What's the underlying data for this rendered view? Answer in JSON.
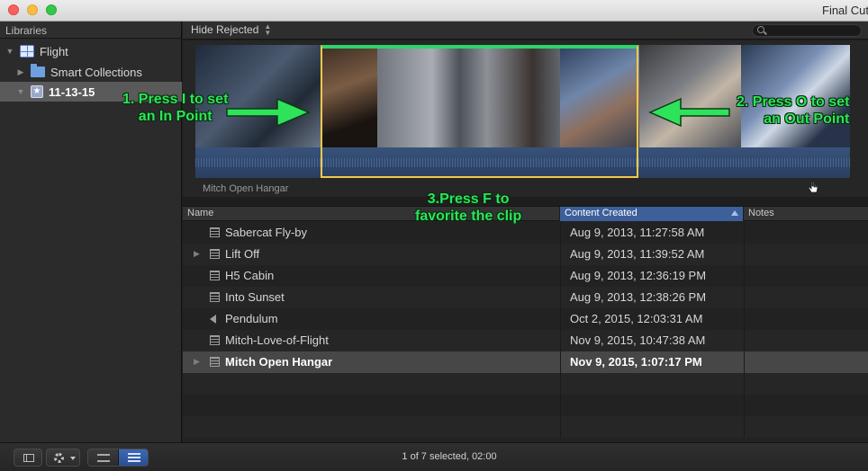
{
  "window": {
    "title": "Final Cut"
  },
  "sidebar": {
    "header": "Libraries",
    "items": [
      {
        "label": "Flight",
        "icon": "library-icon",
        "expanded": true
      },
      {
        "label": "Smart Collections",
        "icon": "folder-icon",
        "expanded": false
      },
      {
        "label": "11-13-15",
        "icon": "event-star-icon",
        "expanded": true,
        "selected": true
      }
    ]
  },
  "toolbar": {
    "filter_label": "Hide Rejected",
    "search_placeholder": ""
  },
  "filmstrip": {
    "clip_label": "Mitch Open Hangar"
  },
  "annotations": {
    "in_line1": "1. Press I to set",
    "in_line2": "an In Point",
    "out_line1": "2. Press O to set",
    "out_line2": "an Out Point",
    "fav_line1": "3.Press F to",
    "fav_line2": "favorite the clip"
  },
  "list": {
    "columns": {
      "name": "Name",
      "content_created": "Content Created",
      "notes": "Notes"
    },
    "rows": [
      {
        "name": "Sabercat Fly-by",
        "created": "Aug 9, 2013, 11:27:58 AM",
        "type": "video",
        "expandable": false
      },
      {
        "name": "Lift Off",
        "created": "Aug 9, 2013, 11:39:52 AM",
        "type": "video",
        "expandable": true
      },
      {
        "name": "H5 Cabin",
        "created": "Aug 9, 2013, 12:36:19 PM",
        "type": "video",
        "expandable": false
      },
      {
        "name": "Into Sunset",
        "created": "Aug 9, 2013, 12:38:26 PM",
        "type": "video",
        "expandable": false
      },
      {
        "name": "Pendulum",
        "created": "Oct 2, 2015, 12:03:31 AM",
        "type": "audio",
        "expandable": false
      },
      {
        "name": "Mitch-Love-of-Flight",
        "created": "Nov 9, 2015, 10:47:38 AM",
        "type": "video",
        "expandable": false
      },
      {
        "name": "Mitch Open Hangar",
        "created": "Nov 9, 2015, 1:07:17 PM",
        "type": "video",
        "expandable": true,
        "selected": true
      }
    ]
  },
  "status": {
    "text": "1 of 7 selected, 02:00"
  },
  "colors": {
    "accent": "#3d5f9a",
    "annotation": "#2ee35a",
    "range_border": "#f2c94c"
  }
}
